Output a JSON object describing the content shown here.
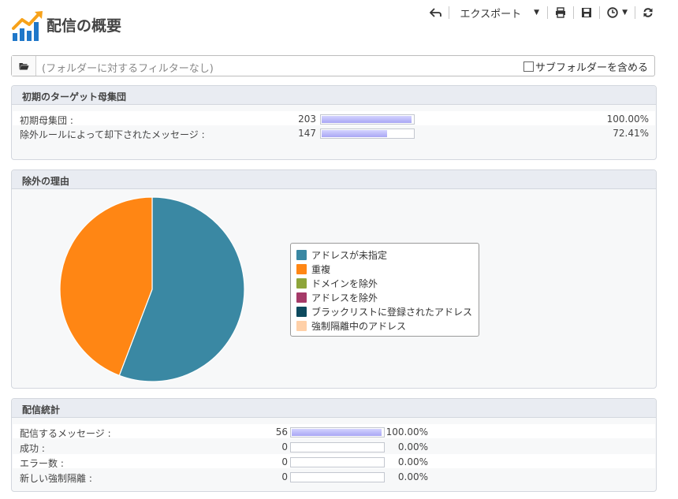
{
  "header": {
    "title": "配信の概要",
    "toolbar": {
      "export_label": "エクスポート"
    }
  },
  "filter": {
    "placeholder": "(フォルダーに対するフィルターなし)",
    "include_subfolders_label": "サブフォルダーを含める",
    "include_subfolders_checked": false
  },
  "initial_target": {
    "title": "初期のターゲット母集団",
    "rows": [
      {
        "label": "初期母集団 :",
        "count": "203",
        "percent": "100.00%",
        "fraction": 1.0
      },
      {
        "label": "除外ルールによって却下されたメッセージ :",
        "count": "147",
        "percent": "72.41%",
        "fraction": 0.7241
      }
    ]
  },
  "exclusion_reasons": {
    "title": "除外の理由",
    "chart_data": {
      "type": "pie",
      "slices": [
        {
          "name": "アドレスが未指定",
          "value": 55.8,
          "color": "#3a88a3"
        },
        {
          "name": "重複",
          "value": 44.2,
          "color": "#ff8614"
        },
        {
          "name": "ドメインを除外",
          "value": 0,
          "color": "#8ea53a"
        },
        {
          "name": "アドレスを除外",
          "value": 0,
          "color": "#a53a68"
        },
        {
          "name": "ブラックリストに登録されたアドレス",
          "value": 0,
          "color": "#0d4a5e"
        },
        {
          "name": "強制隔離中のアドレス",
          "value": 0,
          "color": "#ffd0a8"
        }
      ]
    }
  },
  "delivery_stats": {
    "title": "配信統計",
    "rows": [
      {
        "label": "配信するメッセージ :",
        "count": "56",
        "percent": "100.00%",
        "fraction": 1.0
      },
      {
        "label": "成功 :",
        "count": "0",
        "percent": "0.00%",
        "fraction": 0
      },
      {
        "label": "エラー数 :",
        "count": "0",
        "percent": "0.00%",
        "fraction": 0
      },
      {
        "label": "新しい強制隔離 :",
        "count": "0",
        "percent": "0.00%",
        "fraction": 0
      }
    ]
  },
  "colors": {
    "accent_blue": "#1f77c9",
    "logo_orange": "#f7a21a"
  },
  "icons": [
    "chart-logo-icon",
    "back-icon",
    "print-icon",
    "save-icon",
    "clock-icon",
    "refresh-icon",
    "folder-icon"
  ]
}
